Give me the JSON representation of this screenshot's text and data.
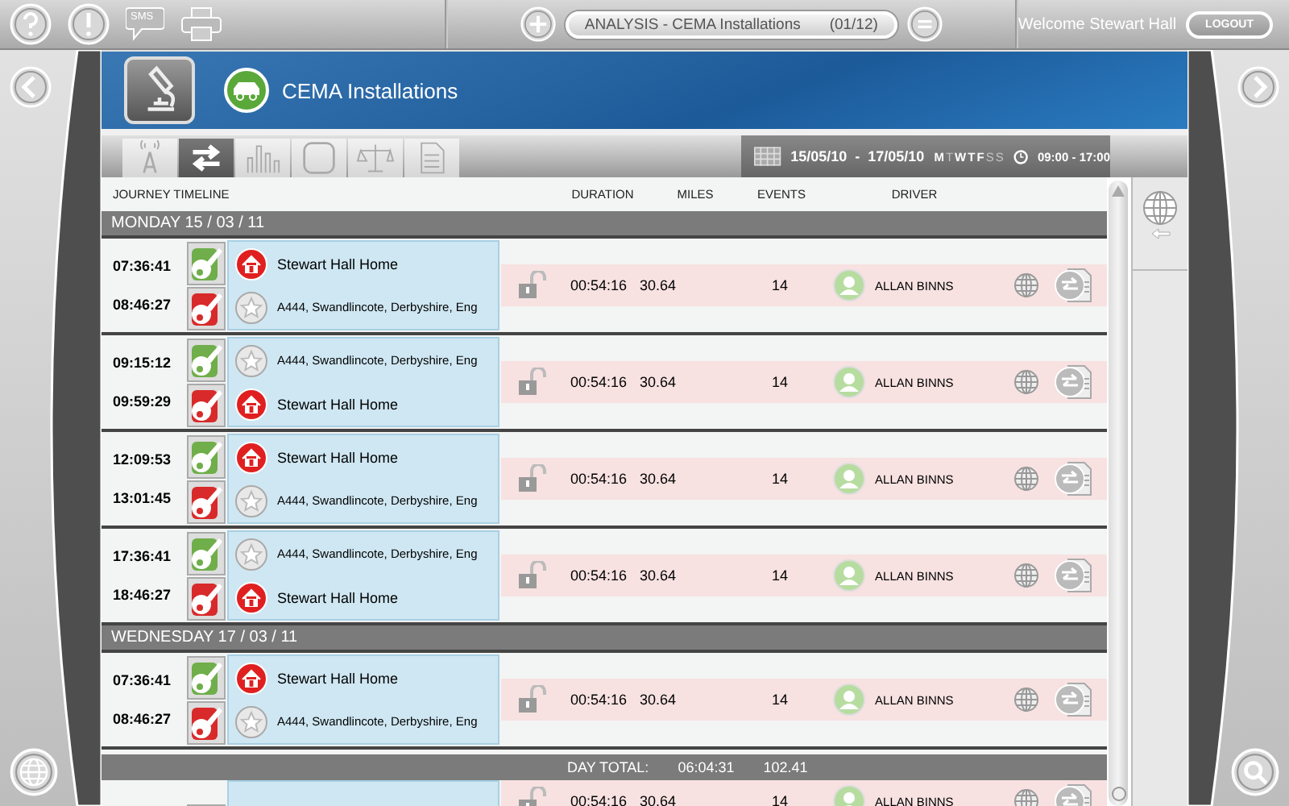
{
  "top_bar": {
    "sms_label": "SMS",
    "title": "ANALYSIS - CEMA Installations",
    "counter": "(01/12)",
    "welcome": "Welcome Stewart Hall",
    "logout": "LOGOUT"
  },
  "header": {
    "title": "CEMA Installations"
  },
  "toolbar": {
    "tabs": [
      {
        "kind": "antenna",
        "selected": false
      },
      {
        "kind": "arrows",
        "selected": true
      },
      {
        "kind": "bars",
        "selected": false
      },
      {
        "kind": "square",
        "selected": false
      },
      {
        "kind": "scales",
        "selected": false
      },
      {
        "kind": "document",
        "selected": false
      }
    ],
    "date_range": "15/05/10  -  17/05/10",
    "days": [
      {
        "letter": "M",
        "on": true
      },
      {
        "letter": "T",
        "on": false
      },
      {
        "letter": "W",
        "on": true
      },
      {
        "letter": "T",
        "on": true
      },
      {
        "letter": "F",
        "on": true
      },
      {
        "letter": "S",
        "on": false
      },
      {
        "letter": "S",
        "on": false
      }
    ],
    "time_range": "09:00 - 17:00"
  },
  "table": {
    "columns": [
      "JOURNEY TIMELINE",
      "DURATION",
      "MILES",
      "EVENTS",
      "DRIVER"
    ],
    "days": [
      {
        "label": "MONDAY 15 / 03 / 11",
        "journeys": [
          {
            "start_time": "07:36:41",
            "end_time": "08:46:27",
            "start_place": {
              "kind": "home",
              "text": "Stewart Hall Home"
            },
            "end_place": {
              "kind": "poi",
              "text": "A444, Swandlincote, Derbyshire, Eng"
            },
            "duration": "00:54:16",
            "miles": "30.64",
            "events": "14",
            "driver": "ALLAN BINNS"
          },
          {
            "start_time": "09:15:12",
            "end_time": "09:59:29",
            "start_place": {
              "kind": "poi",
              "text": "A444, Swandlincote, Derbyshire, Eng"
            },
            "end_place": {
              "kind": "home",
              "text": "Stewart Hall Home"
            },
            "duration": "00:54:16",
            "miles": "30.64",
            "events": "14",
            "driver": "ALLAN BINNS"
          },
          {
            "start_time": "12:09:53",
            "end_time": "13:01:45",
            "start_place": {
              "kind": "home",
              "text": "Stewart Hall Home"
            },
            "end_place": {
              "kind": "poi",
              "text": "A444, Swandlincote, Derbyshire, Eng"
            },
            "duration": "00:54:16",
            "miles": "30.64",
            "events": "14",
            "driver": "ALLAN BINNS"
          },
          {
            "start_time": "17:36:41",
            "end_time": "18:46:27",
            "start_place": {
              "kind": "poi",
              "text": "A444, Swandlincote, Derbyshire, Eng"
            },
            "end_place": {
              "kind": "home",
              "text": "Stewart Hall Home"
            },
            "duration": "00:54:16",
            "miles": "30.64",
            "events": "14",
            "driver": "ALLAN BINNS"
          }
        ]
      },
      {
        "label": "WEDNESDAY 17 / 03 / 11",
        "journeys": [
          {
            "start_time": "07:36:41",
            "end_time": "08:46:27",
            "start_place": {
              "kind": "home",
              "text": "Stewart Hall Home"
            },
            "end_place": {
              "kind": "poi",
              "text": "A444, Swandlincote, Derbyshire, Eng"
            },
            "duration": "00:54:16",
            "miles": "30.64",
            "events": "14",
            "driver": "ALLAN BINNS"
          }
        ]
      }
    ],
    "day_total": {
      "label": "DAY TOTAL:",
      "duration": "06:04:31",
      "miles": "102.41"
    },
    "partial_journey": {
      "duration": "00:54:16",
      "miles": "30.64",
      "events": "14",
      "driver": "ALLAN BINNS"
    }
  }
}
